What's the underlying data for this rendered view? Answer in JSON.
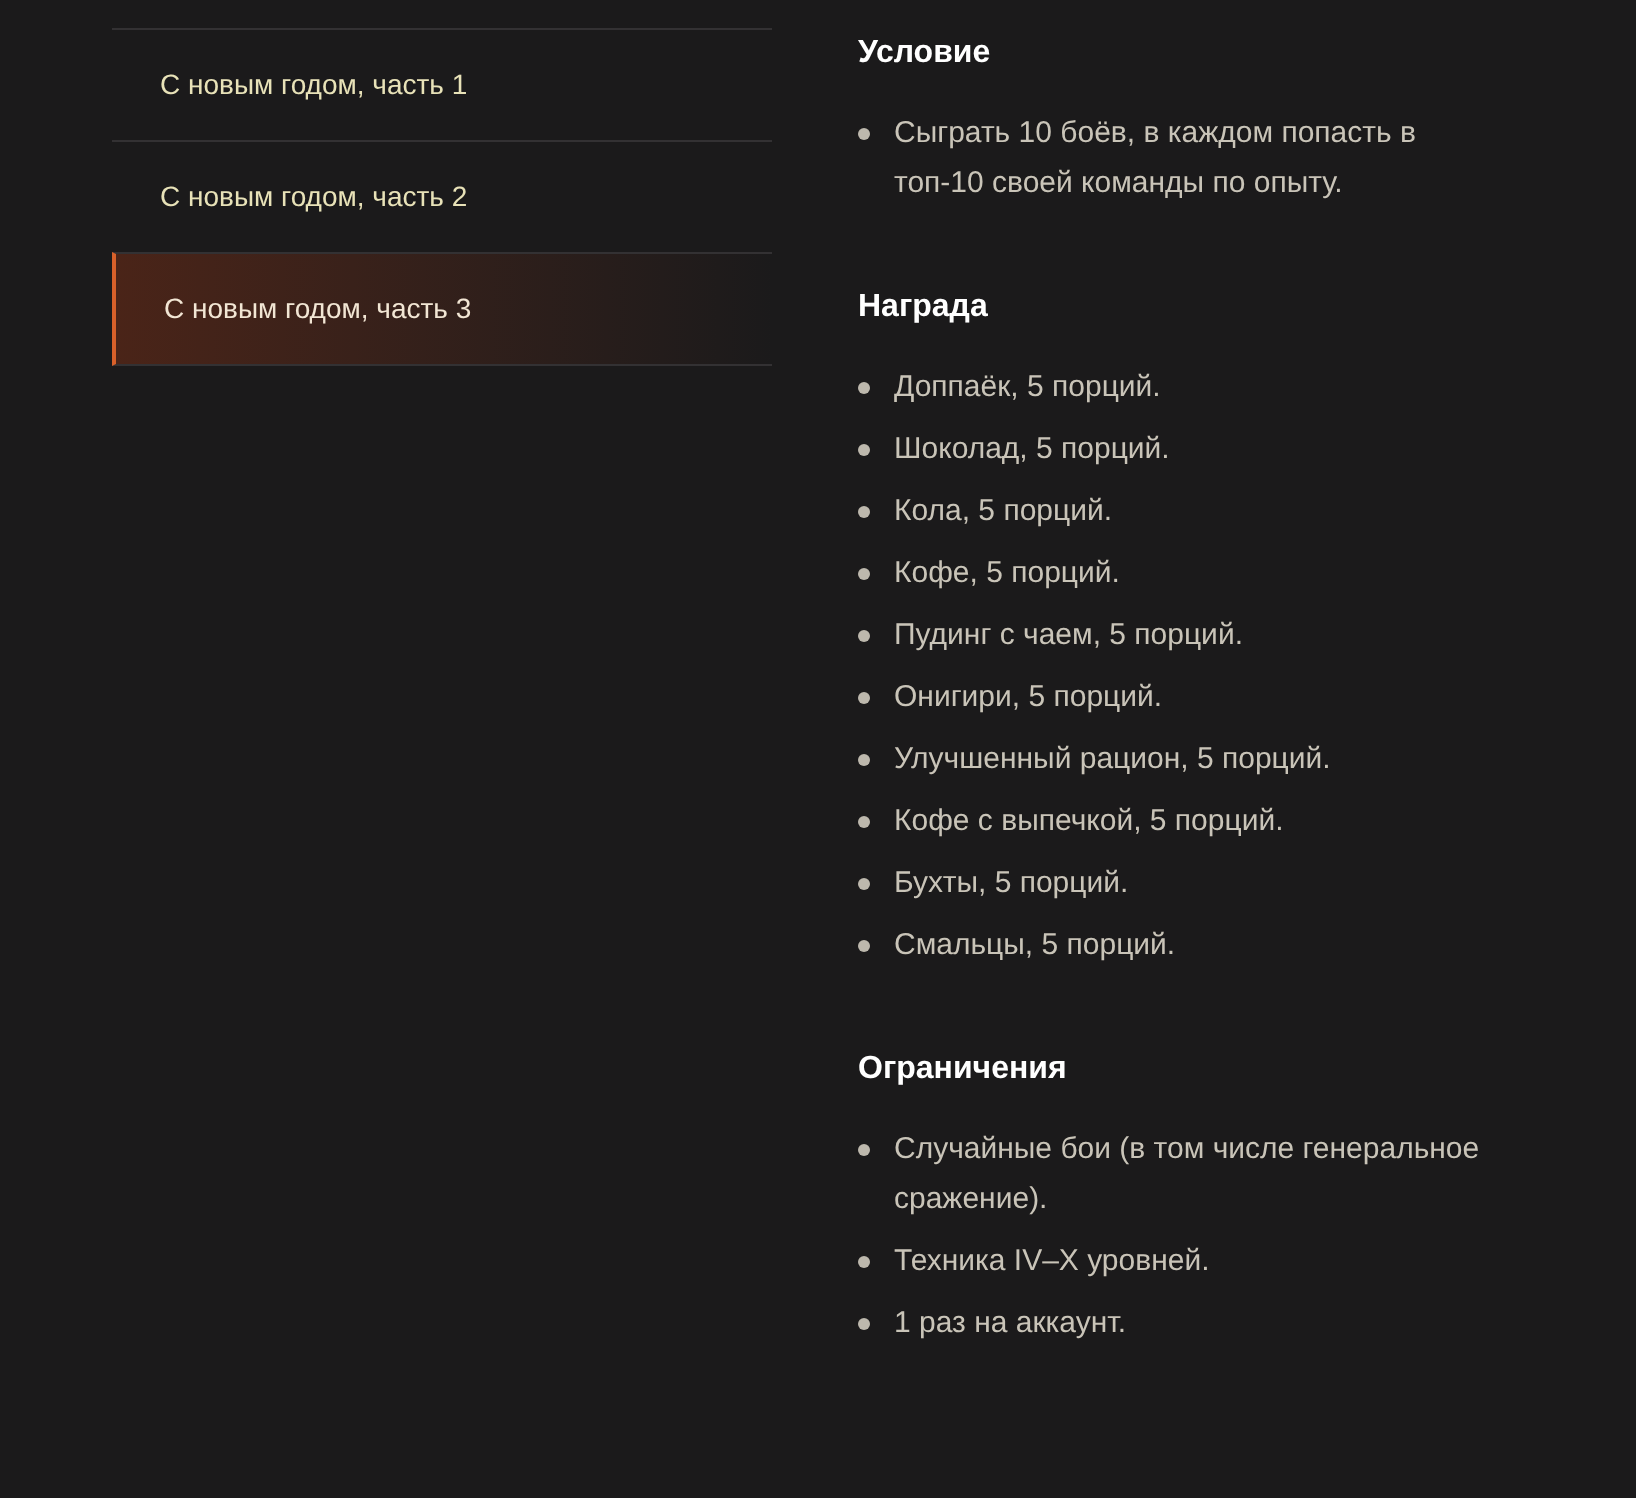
{
  "tabs": [
    {
      "label": "С новым годом, часть 1",
      "selected": false
    },
    {
      "label": "С новым годом, часть 2",
      "selected": false
    },
    {
      "label": "С новым годом, часть 3",
      "selected": true
    }
  ],
  "sections": [
    {
      "title": "Условие",
      "items": [
        "Сыграть 10 боёв, в каждом попасть в топ-10 своей команды по опыту."
      ]
    },
    {
      "title": "Награда",
      "items": [
        "Доппаёк, 5 порций.",
        "Шоколад, 5 порций.",
        "Кола, 5 порций.",
        "Кофе, 5 порций.",
        "Пудинг с чаем, 5 порций.",
        "Онигири, 5 порций.",
        "Улучшенный рацион, 5 порций.",
        "Кофе с выпечкой, 5 порций.",
        "Бухты, 5 порций.",
        "Смальцы, 5 порций."
      ]
    },
    {
      "title": "Ограничения",
      "items": [
        "Случайные бои (в том числе генеральное сражение).",
        "Техника IV–X уровней.",
        "1 раз на аккаунт."
      ]
    }
  ]
}
